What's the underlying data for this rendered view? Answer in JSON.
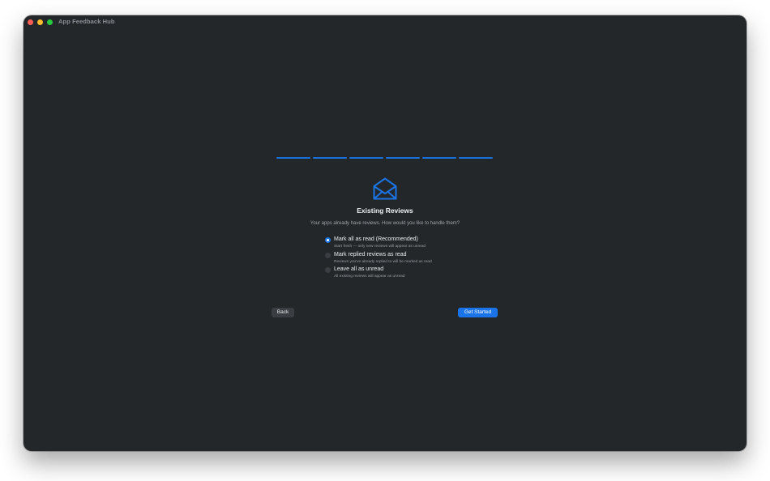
{
  "window": {
    "title": "App Feedback Hub"
  },
  "progress": {
    "total_steps": 6,
    "completed_steps": 6,
    "color": "#1a6fd8"
  },
  "icon": "envelope-open-icon",
  "heading": "Existing Reviews",
  "subtitle": "Your apps already have reviews. How would you like to handle them?",
  "options": [
    {
      "label": "Mark all as read (Recommended)",
      "description": "Start fresh — only new reviews will appear as unread",
      "selected": true
    },
    {
      "label": "Mark replied reviews as read",
      "description": "Reviews you've already replied to will be marked as read",
      "selected": false
    },
    {
      "label": "Leave all as unread",
      "description": "All existing reviews will appear as unread",
      "selected": false
    }
  ],
  "buttons": {
    "back": "Back",
    "primary": "Get Started"
  },
  "colors": {
    "accent": "#1a73e8",
    "window_bg": "#23272a"
  }
}
